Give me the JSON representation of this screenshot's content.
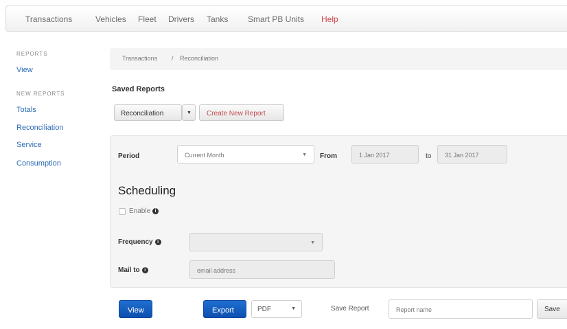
{
  "nav": {
    "items": [
      {
        "label": "Transactions"
      },
      {
        "label": "Vehicles"
      },
      {
        "label": "Fleet"
      },
      {
        "label": "Drivers"
      },
      {
        "label": "Tanks"
      },
      {
        "label": "Smart PB Units"
      },
      {
        "label": "Help"
      }
    ]
  },
  "sidebar": {
    "reports_heading": "REPORTS",
    "view_link": "View",
    "new_reports_heading": "NEW REPORTS",
    "links": [
      "Totals",
      "Reconciliation",
      "Service",
      "Consumption"
    ]
  },
  "breadcrumb": {
    "parent": "Transactions",
    "separator": "/",
    "current": "Reconciliation"
  },
  "saved_reports": {
    "title": "Saved Reports",
    "dropdown_label": "Reconciliation",
    "create_label": "Create New Report"
  },
  "form": {
    "period_label": "Period",
    "period_value": "Current Month",
    "from_label": "From",
    "from_value": "1 Jan 2017",
    "to_label": "to",
    "to_value": "31 Jan 2017",
    "scheduling_heading": "Scheduling",
    "enable_label": "Enable",
    "frequency_label": "Frequency",
    "frequency_value": "",
    "mail_to_label": "Mail to",
    "mail_to_placeholder": "email address"
  },
  "actions": {
    "view_label": "View",
    "export_label": "Export",
    "format_value": "PDF",
    "save_report_label": "Save Report",
    "report_name_placeholder": "Report name",
    "save_label": "Save"
  },
  "icons": {
    "info": "info-circle-icon",
    "caret": "caret-down-icon",
    "checkbox": "checkbox-icon"
  },
  "colors": {
    "link": "#2b6bb5",
    "help": "#d0454a",
    "primary": "#1560c8"
  }
}
